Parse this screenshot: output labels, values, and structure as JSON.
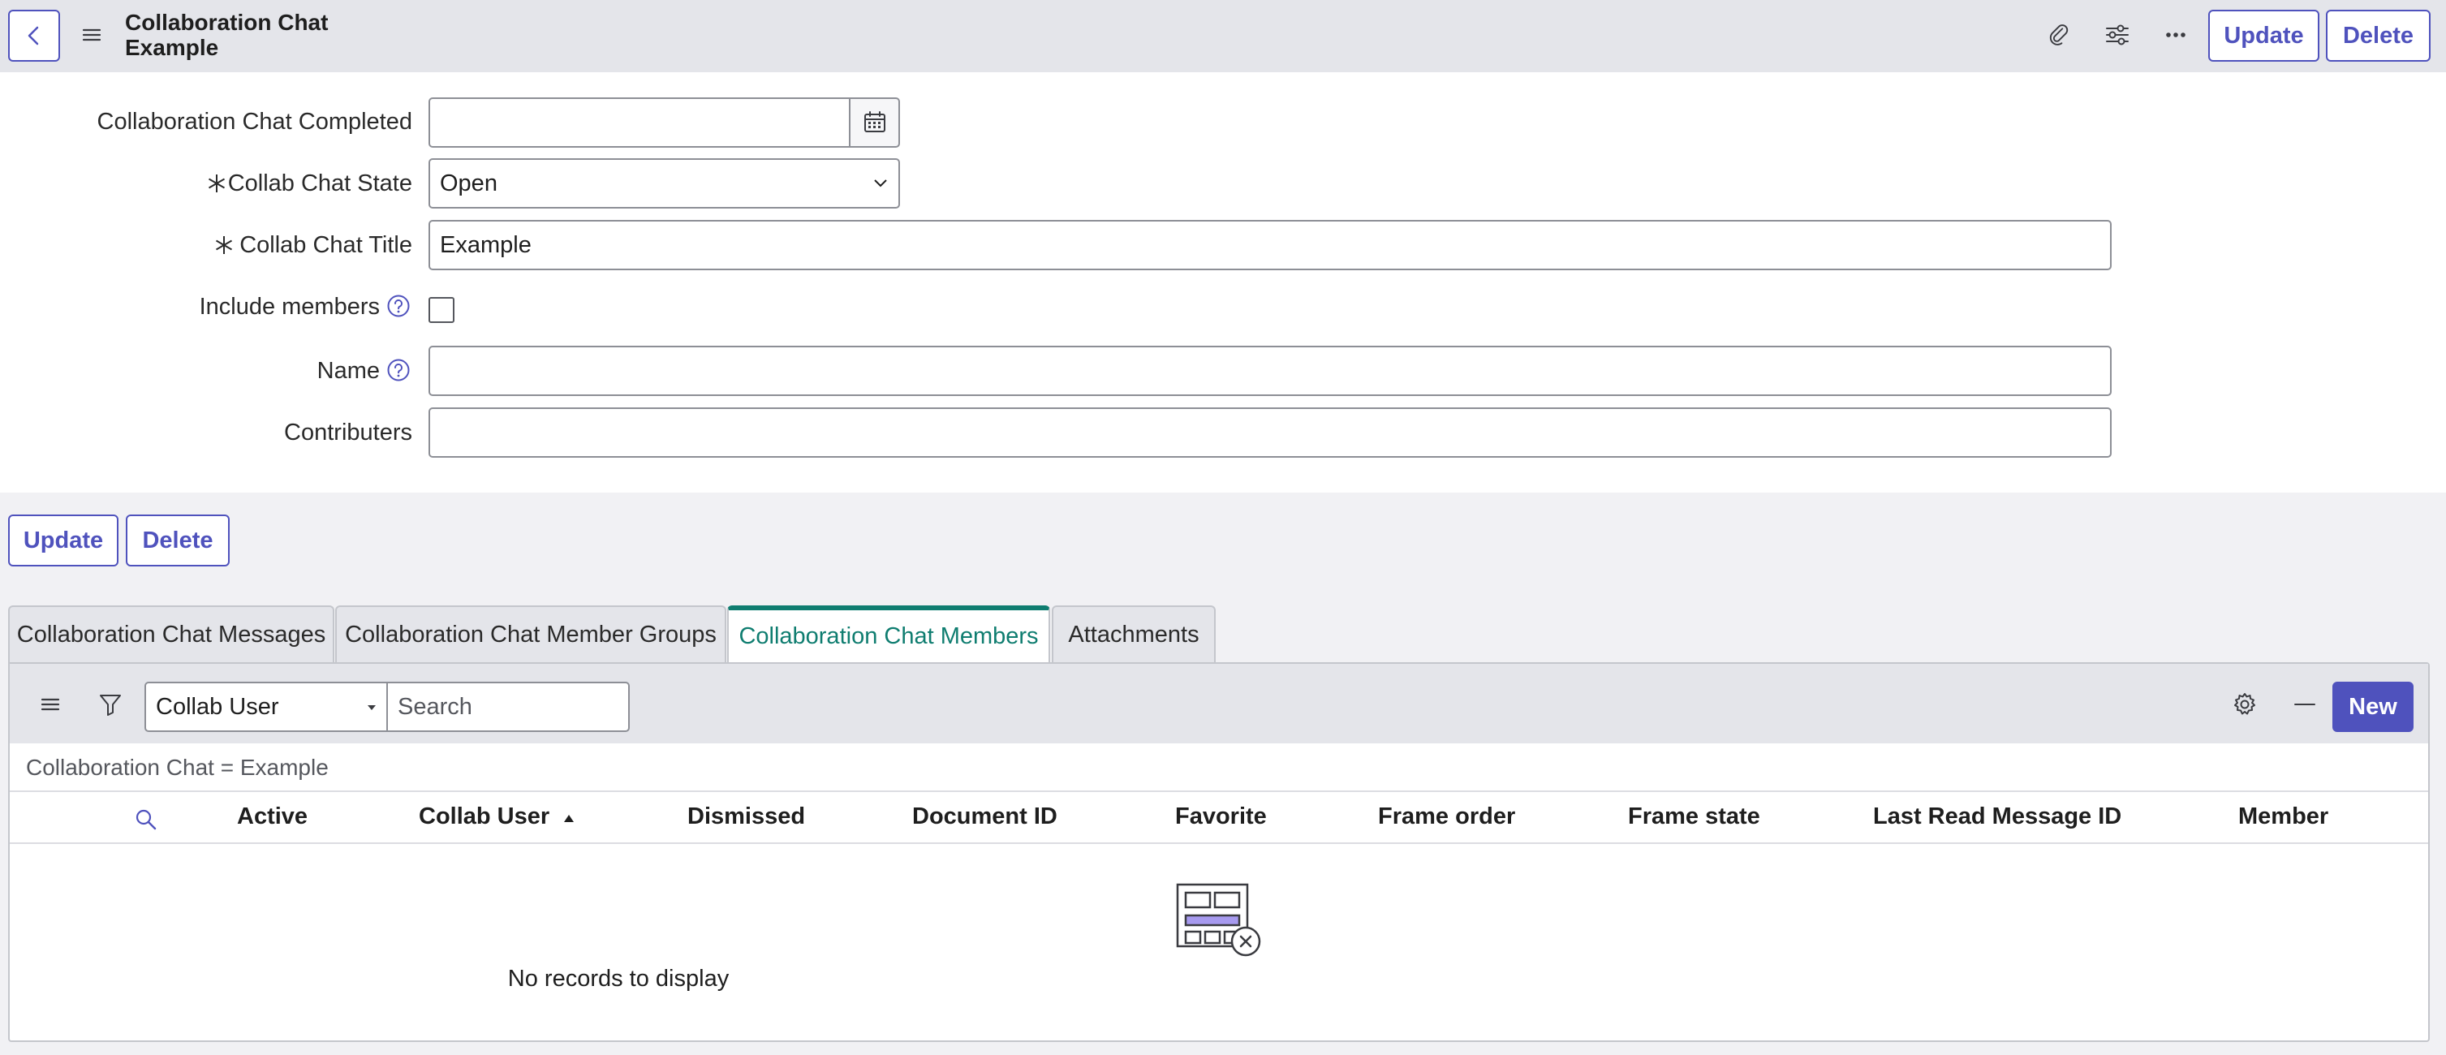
{
  "header": {
    "title": "Collaboration Chat Example",
    "update_label": "Update",
    "delete_label": "Delete"
  },
  "form": {
    "completed_label": "Collaboration Chat Completed",
    "completed_value": "",
    "state_label": "Collab Chat State",
    "state_value": "Open",
    "title_label": "Collab Chat Title",
    "title_value": "Example",
    "include_members_label": "Include members",
    "include_members_checked": false,
    "name_label": "Name",
    "name_value": "",
    "contributers_label": "Contributers",
    "contributers_value": ""
  },
  "actions": {
    "update_label": "Update",
    "delete_label": "Delete"
  },
  "tabs": [
    {
      "label": "Collaboration Chat Messages",
      "active": false
    },
    {
      "label": "Collaboration Chat Member Groups",
      "active": false
    },
    {
      "label": "Collaboration Chat Members",
      "active": true
    },
    {
      "label": "Attachments",
      "active": false
    }
  ],
  "list": {
    "search_field": "Collab User",
    "search_placeholder": "Search",
    "new_label": "New",
    "filter_breadcrumb": "Collaboration Chat = Example",
    "columns": [
      "Active",
      "Collab User",
      "Dismissed",
      "Document ID",
      "Favorite",
      "Frame order",
      "Frame state",
      "Last Read Message ID",
      "Member"
    ],
    "sorted_column": "Collab User",
    "sort_direction": "ascending",
    "empty_message": "No records to display"
  },
  "colors": {
    "accent": "#4f52bd",
    "active_tab": "#0f7d70",
    "header_bg": "#e4e5ea"
  }
}
